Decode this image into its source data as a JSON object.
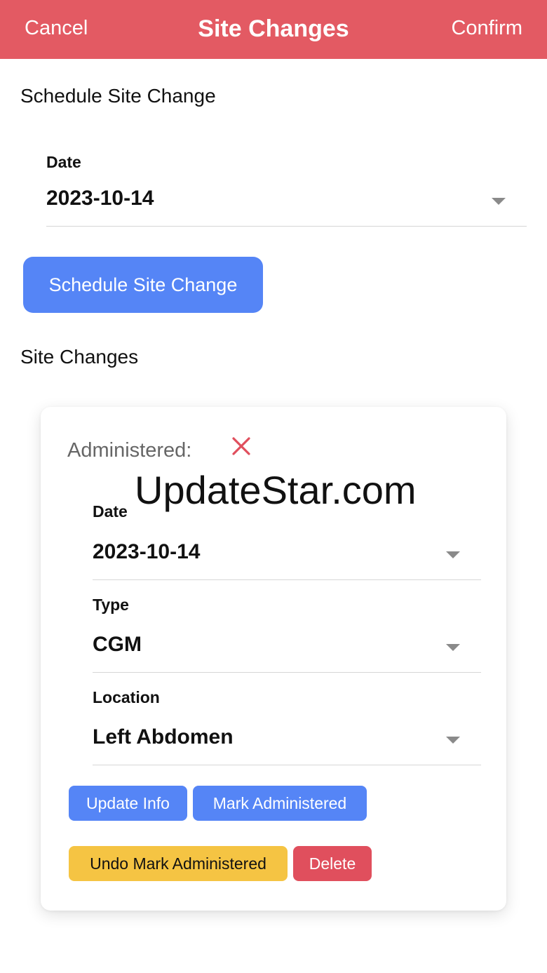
{
  "header": {
    "cancel_label": "Cancel",
    "title": "Site Changes",
    "confirm_label": "Confirm",
    "background_color": "#e35a63"
  },
  "schedule_section": {
    "heading": "Schedule Site Change",
    "date_label": "Date",
    "date_value": "2023-10-14",
    "button_label": "Schedule Site Change"
  },
  "site_changes_section": {
    "heading": "Site Changes"
  },
  "card": {
    "administered_label": "Administered:",
    "administered_icon": "x-mark-icon",
    "watermark": "UpdateStar.com",
    "date_label": "Date",
    "date_value": "2023-10-14",
    "type_label": "Type",
    "type_value": "CGM",
    "location_label": "Location",
    "location_value": "Left Abdomen",
    "buttons": {
      "update_info": "Update Info",
      "mark_administered": "Mark Administered",
      "undo_mark_administered": "Undo Mark Administered",
      "delete": "Delete"
    }
  },
  "colors": {
    "primary_blue": "#5585f6",
    "warning_yellow": "#f5c443",
    "danger_red": "#e04f5d"
  }
}
